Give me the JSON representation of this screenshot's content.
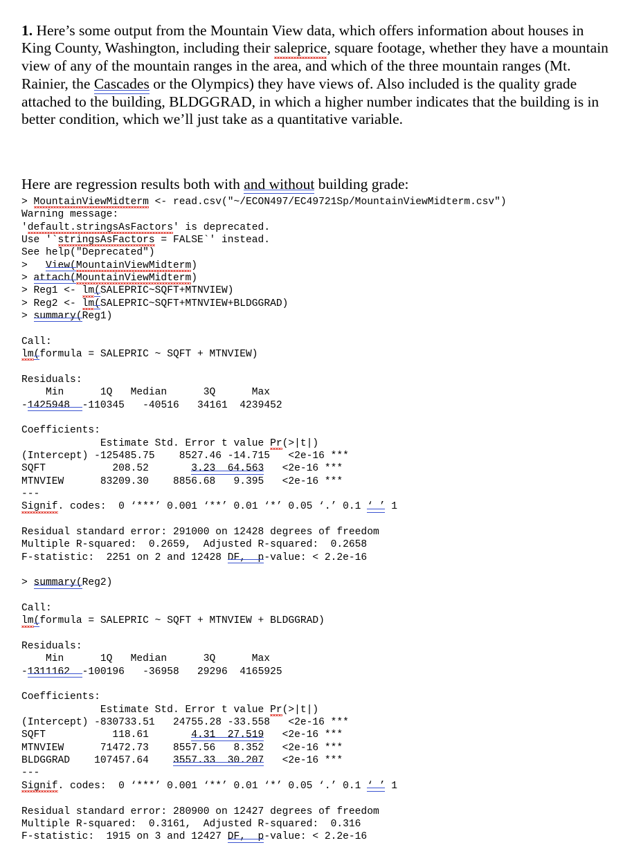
{
  "document": {
    "intro": {
      "number": "1.",
      "text_a": "  Here’s some output from the Mountain View data, which offers information about houses in King County, Washington, including their ",
      "misspelled_1": "saleprice",
      "text_b": ", square footage, whether they have a mountain view of any of the mountain ranges in the area, and which of the three mountain ranges (Mt. Rainier, the ",
      "grammar_1": "Cascades",
      "text_c": " or the Olympics) they have views of. Also included is the quality grade attached to the building, BLDGGRAD, in which a higher number indicates that the building is in better condition, which we’ll just take as a quantitative variable."
    },
    "lead_in": {
      "text_a": "Here are regression results both with ",
      "grammar_1": "and  without",
      "text_b": " building grade:"
    }
  },
  "console": {
    "lines": [
      {
        "id": "l01",
        "segments": [
          {
            "t": "> ",
            "style": "plain"
          },
          {
            "t": "MountainViewMidterm",
            "style": "spell"
          },
          {
            "t": " <- read.csv(\"~/ECON497/EC49721Sp/MountainViewMidterm.csv\")",
            "style": "plain"
          }
        ]
      },
      {
        "id": "l02",
        "segments": [
          {
            "t": "Warning message:",
            "style": "plain"
          }
        ]
      },
      {
        "id": "l03",
        "segments": [
          {
            "t": "'",
            "style": "plain"
          },
          {
            "t": "default.stringsAsFactors",
            "style": "spell"
          },
          {
            "t": "' is deprecated.",
            "style": "plain"
          }
        ]
      },
      {
        "id": "l04",
        "segments": [
          {
            "t": "Use '`",
            "style": "plain"
          },
          {
            "t": "stringsAsFactors",
            "style": "spell"
          },
          {
            "t": " = FALSE`' instead.",
            "style": "plain"
          }
        ]
      },
      {
        "id": "l05",
        "segments": [
          {
            "t": "See help(\"Deprecated\")",
            "style": "plain"
          }
        ]
      },
      {
        "id": "l06",
        "segments": [
          {
            "t": ">   ",
            "style": "plain"
          },
          {
            "t": "View(",
            "style": "grammar"
          },
          {
            "t": "MountainViewMidterm",
            "style": "spell"
          },
          {
            "t": ")",
            "style": "plain"
          }
        ]
      },
      {
        "id": "l07",
        "segments": [
          {
            "t": "> ",
            "style": "plain"
          },
          {
            "t": "attach(",
            "style": "grammar"
          },
          {
            "t": "MountainViewMidterm",
            "style": "spell"
          },
          {
            "t": ")",
            "style": "plain"
          }
        ]
      },
      {
        "id": "l08",
        "segments": [
          {
            "t": "> Reg1 <- ",
            "style": "plain"
          },
          {
            "t": "lm",
            "style": "spell"
          },
          {
            "t": "(",
            "style": "grammar"
          },
          {
            "t": "SALEPRIC~SQFT+MTNVIEW)",
            "style": "plain"
          }
        ]
      },
      {
        "id": "l09",
        "segments": [
          {
            "t": "> Reg2 <- ",
            "style": "plain"
          },
          {
            "t": "lm",
            "style": "spell"
          },
          {
            "t": "(",
            "style": "grammar"
          },
          {
            "t": "SALEPRIC~SQFT+MTNVIEW+BLDGGRAD)",
            "style": "plain"
          }
        ]
      },
      {
        "id": "l10",
        "segments": [
          {
            "t": "> ",
            "style": "plain"
          },
          {
            "t": "summary(",
            "style": "grammar"
          },
          {
            "t": "Reg1)",
            "style": "plain"
          }
        ]
      },
      {
        "id": "l11",
        "segments": [
          {
            "t": "",
            "style": "plain"
          }
        ]
      },
      {
        "id": "l12",
        "segments": [
          {
            "t": "Call:",
            "style": "plain"
          }
        ]
      },
      {
        "id": "l13",
        "segments": [
          {
            "t": "lm",
            "style": "spell"
          },
          {
            "t": "(",
            "style": "grammar"
          },
          {
            "t": "formula = SALEPRIC ~ SQFT + MTNVIEW)",
            "style": "plain"
          }
        ]
      },
      {
        "id": "l14",
        "segments": [
          {
            "t": "",
            "style": "plain"
          }
        ]
      },
      {
        "id": "l15",
        "segments": [
          {
            "t": "Residuals:",
            "style": "plain"
          }
        ]
      },
      {
        "id": "l16",
        "segments": [
          {
            "t": "    Min      1Q   Median      3Q      Max ",
            "style": "plain"
          }
        ]
      },
      {
        "id": "l17",
        "segments": [
          {
            "t": "-",
            "style": "plain"
          },
          {
            "t": "1425948  ",
            "style": "grammar"
          },
          {
            "t": "-110345   -40516   34161  4239452 ",
            "style": "plain"
          }
        ]
      },
      {
        "id": "l18",
        "segments": [
          {
            "t": "",
            "style": "plain"
          }
        ]
      },
      {
        "id": "l19",
        "segments": [
          {
            "t": "Coefficients:",
            "style": "plain"
          }
        ]
      },
      {
        "id": "l20",
        "segments": [
          {
            "t": "             Estimate Std. Error t value ",
            "style": "plain"
          },
          {
            "t": "Pr",
            "style": "spell"
          },
          {
            "t": "(>|t|)    ",
            "style": "plain"
          }
        ]
      },
      {
        "id": "l21",
        "segments": [
          {
            "t": "(Intercept) -125485.75    8527.46 -14.715   <2e-16 ***",
            "style": "plain"
          }
        ]
      },
      {
        "id": "l22",
        "segments": [
          {
            "t": "SQFT           208.52       ",
            "style": "plain"
          },
          {
            "t": "3.23  64.563",
            "style": "grammar"
          },
          {
            "t": "   <2e-16 ***",
            "style": "plain"
          }
        ]
      },
      {
        "id": "l23",
        "segments": [
          {
            "t": "MTNVIEW      83209.30    8856.68   9.395   <2e-16 ***",
            "style": "plain"
          }
        ]
      },
      {
        "id": "l24",
        "segments": [
          {
            "t": "---",
            "style": "plain"
          }
        ]
      },
      {
        "id": "l25",
        "segments": [
          {
            "t": "Signif",
            "style": "spell"
          },
          {
            "t": ". codes:  0 ‘***’ 0.001 ‘**’ 0.01 ‘*’ 0.05 ‘.’ 0.1 ",
            "style": "plain"
          },
          {
            "t": "‘ ’",
            "style": "grammar"
          },
          {
            "t": " 1",
            "style": "plain"
          }
        ]
      },
      {
        "id": "l26",
        "segments": [
          {
            "t": "",
            "style": "plain"
          }
        ]
      },
      {
        "id": "l27",
        "segments": [
          {
            "t": "Residual standard error: 291000 on 12428 degrees of freedom",
            "style": "plain"
          }
        ]
      },
      {
        "id": "l28",
        "segments": [
          {
            "t": "Multiple R-squared:  0.2659,  Adjusted R-squared:  0.2658 ",
            "style": "plain"
          }
        ]
      },
      {
        "id": "l29",
        "segments": [
          {
            "t": "F-statistic:  2251 on 2 and 12428 ",
            "style": "plain"
          },
          {
            "t": "DF,  p",
            "style": "grammar"
          },
          {
            "t": "-value: < 2.2e-16 ",
            "style": "plain"
          }
        ]
      },
      {
        "id": "l30",
        "segments": [
          {
            "t": "",
            "style": "plain"
          }
        ]
      },
      {
        "id": "l31",
        "segments": [
          {
            "t": "> ",
            "style": "plain"
          },
          {
            "t": "summary(",
            "style": "grammar"
          },
          {
            "t": "Reg2)",
            "style": "plain"
          }
        ]
      },
      {
        "id": "l32",
        "segments": [
          {
            "t": "",
            "style": "plain"
          }
        ]
      },
      {
        "id": "l33",
        "segments": [
          {
            "t": "Call:",
            "style": "plain"
          }
        ]
      },
      {
        "id": "l34",
        "segments": [
          {
            "t": "lm",
            "style": "spell"
          },
          {
            "t": "(",
            "style": "grammar"
          },
          {
            "t": "formula = SALEPRIC ~ SQFT + MTNVIEW + BLDGGRAD)",
            "style": "plain"
          }
        ]
      },
      {
        "id": "l35",
        "segments": [
          {
            "t": "",
            "style": "plain"
          }
        ]
      },
      {
        "id": "l36",
        "segments": [
          {
            "t": "Residuals:",
            "style": "plain"
          }
        ]
      },
      {
        "id": "l37",
        "segments": [
          {
            "t": "    Min      1Q   Median      3Q      Max ",
            "style": "plain"
          }
        ]
      },
      {
        "id": "l38",
        "segments": [
          {
            "t": "-",
            "style": "plain"
          },
          {
            "t": "1311162  ",
            "style": "grammar"
          },
          {
            "t": "-100196   -36958   29296  4165925 ",
            "style": "plain"
          }
        ]
      },
      {
        "id": "l39",
        "segments": [
          {
            "t": "",
            "style": "plain"
          }
        ]
      },
      {
        "id": "l40",
        "segments": [
          {
            "t": "Coefficients:",
            "style": "plain"
          }
        ]
      },
      {
        "id": "l41",
        "segments": [
          {
            "t": "             Estimate Std. Error t value ",
            "style": "plain"
          },
          {
            "t": "Pr",
            "style": "spell"
          },
          {
            "t": "(>|t|)    ",
            "style": "plain"
          }
        ]
      },
      {
        "id": "l42",
        "segments": [
          {
            "t": "(Intercept) -830733.51   24755.28 -33.558   <2e-16 ***",
            "style": "plain"
          }
        ]
      },
      {
        "id": "l43",
        "segments": [
          {
            "t": "SQFT           118.61       ",
            "style": "plain"
          },
          {
            "t": "4.31  27.519",
            "style": "grammar"
          },
          {
            "t": "   <2e-16 ***",
            "style": "plain"
          }
        ]
      },
      {
        "id": "l44",
        "segments": [
          {
            "t": "MTNVIEW      71472.73    8557.56   8.352   <2e-16 ***",
            "style": "plain"
          }
        ]
      },
      {
        "id": "l45",
        "segments": [
          {
            "t": "BLDGGRAD    107457.64    ",
            "style": "plain"
          },
          {
            "t": "3557.33  30.207",
            "style": "grammar"
          },
          {
            "t": "   <2e-16 ***",
            "style": "plain"
          }
        ]
      },
      {
        "id": "l46",
        "segments": [
          {
            "t": "---",
            "style": "plain"
          }
        ]
      },
      {
        "id": "l47",
        "segments": [
          {
            "t": "Signif",
            "style": "spell"
          },
          {
            "t": ". codes:  0 ‘***’ 0.001 ‘**’ 0.01 ‘*’ 0.05 ‘.’ 0.1 ",
            "style": "plain"
          },
          {
            "t": "‘ ’",
            "style": "grammar"
          },
          {
            "t": " 1",
            "style": "plain"
          }
        ]
      },
      {
        "id": "l48",
        "segments": [
          {
            "t": "",
            "style": "plain"
          }
        ]
      },
      {
        "id": "l49",
        "segments": [
          {
            "t": "Residual standard error: 280900 on 12427 degrees of freedom",
            "style": "plain"
          }
        ]
      },
      {
        "id": "l50",
        "segments": [
          {
            "t": "Multiple R-squared:  0.3161,  Adjusted R-squared:  0.316 ",
            "style": "plain"
          }
        ]
      },
      {
        "id": "l51",
        "segments": [
          {
            "t": "F-statistic:  1915 on 3 and 12427 ",
            "style": "plain"
          },
          {
            "t": "DF,  p",
            "style": "grammar"
          },
          {
            "t": "-value: < 2.2e-16 ",
            "style": "plain"
          }
        ]
      }
    ]
  },
  "regressions": [
    {
      "name": "Reg1",
      "formula": "SALEPRIC ~ SQFT + MTNVIEW",
      "residuals": {
        "Min": "-1425948",
        "1Q": "-110345",
        "Median": "-40516",
        "3Q": "34161",
        "Max": "4239452"
      },
      "columns": [
        "",
        "Estimate",
        "Std. Error",
        "t value",
        "Pr(>|t|)",
        ""
      ],
      "rows": [
        {
          "term": "(Intercept)",
          "estimate": "-125485.75",
          "std_error": "8527.46",
          "t_value": "-14.715",
          "p_value": "<2e-16",
          "signif": "***"
        },
        {
          "term": "SQFT",
          "estimate": "208.52",
          "std_error": "3.23",
          "t_value": "64.563",
          "p_value": "<2e-16",
          "signif": "***"
        },
        {
          "term": "MTNVIEW",
          "estimate": "83209.30",
          "std_error": "8856.68",
          "t_value": "9.395",
          "p_value": "<2e-16",
          "signif": "***"
        }
      ],
      "residual_standard_error": "291000",
      "residual_df": "12428",
      "multiple_r_squared": "0.2659",
      "adjusted_r_squared": "0.2658",
      "f_statistic": "2251",
      "f_df1": "2",
      "f_df2": "12428",
      "p_value": "< 2.2e-16"
    },
    {
      "name": "Reg2",
      "formula": "SALEPRIC ~ SQFT + MTNVIEW + BLDGGRAD",
      "residuals": {
        "Min": "-1311162",
        "1Q": "-100196",
        "Median": "-36958",
        "3Q": "29296",
        "Max": "4165925"
      },
      "columns": [
        "",
        "Estimate",
        "Std. Error",
        "t value",
        "Pr(>|t|)",
        ""
      ],
      "rows": [
        {
          "term": "(Intercept)",
          "estimate": "-830733.51",
          "std_error": "24755.28",
          "t_value": "-33.558",
          "p_value": "<2e-16",
          "signif": "***"
        },
        {
          "term": "SQFT",
          "estimate": "118.61",
          "std_error": "4.31",
          "t_value": "27.519",
          "p_value": "<2e-16",
          "signif": "***"
        },
        {
          "term": "MTNVIEW",
          "estimate": "71472.73",
          "std_error": "8557.56",
          "t_value": "8.352",
          "p_value": "<2e-16",
          "signif": "***"
        },
        {
          "term": "BLDGGRAD",
          "estimate": "107457.64",
          "std_error": "3557.33",
          "t_value": "30.207",
          "p_value": "<2e-16",
          "signif": "***"
        }
      ],
      "residual_standard_error": "280900",
      "residual_df": "12427",
      "multiple_r_squared": "0.3161",
      "adjusted_r_squared": "0.316",
      "f_statistic": "1915",
      "f_df1": "3",
      "f_df2": "12427",
      "p_value": "< 2.2e-16"
    }
  ],
  "colors": {
    "spellcheck_underline": "#e03a2f",
    "grammar_underline": "#3a53d0",
    "text": "#000000",
    "background": "#ffffff"
  }
}
